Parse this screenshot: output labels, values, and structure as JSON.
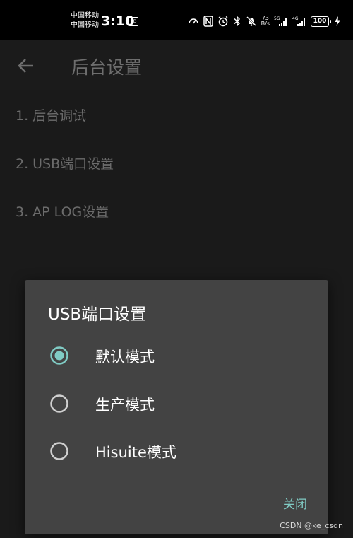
{
  "status_bar": {
    "carrier_1": "中国移动",
    "carrier_2": "中国移动",
    "time": "3:10",
    "hd_badge": "HD",
    "net_speed_value": "73",
    "net_speed_unit": "B/s",
    "battery": "100",
    "icons": [
      "speed-icon",
      "nfc-icon",
      "alarm-icon",
      "bluetooth-icon",
      "mute-icon",
      "signal-5g-icon",
      "signal-4g-icon",
      "battery-icon",
      "charging-icon"
    ]
  },
  "app_bar": {
    "title": "后台设置",
    "back_icon": "arrow-left-icon"
  },
  "settings": {
    "items": [
      {
        "label": "1. 后台调试"
      },
      {
        "label": "2. USB端口设置"
      },
      {
        "label": "3. AP LOG设置"
      }
    ]
  },
  "dialog": {
    "title": "USB端口设置",
    "options": [
      {
        "label": "默认模式",
        "selected": true
      },
      {
        "label": "生产模式",
        "selected": false
      },
      {
        "label": "Hisuite模式",
        "selected": false
      }
    ],
    "close_label": "关闭"
  },
  "watermark": "CSDN @ke_csdn",
  "colors": {
    "accent": "#80cbc4",
    "dialog_bg": "#434343",
    "background": "#1a1a1a"
  }
}
